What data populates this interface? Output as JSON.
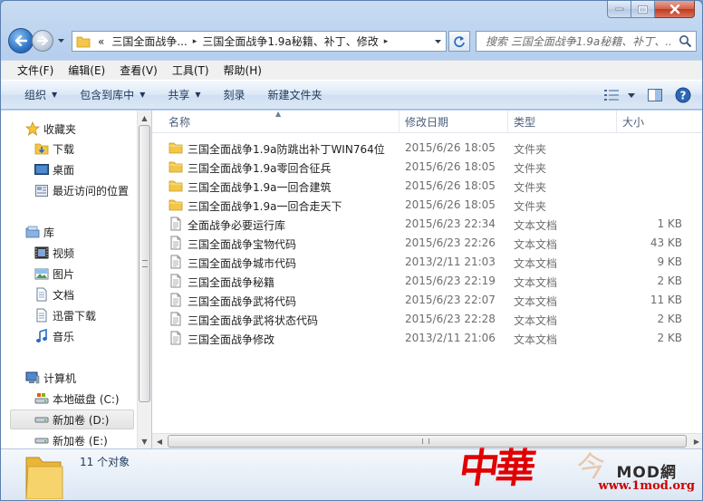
{
  "window": {
    "minimize_glyph": "–",
    "maximize_glyph": "□",
    "close_glyph": "✕"
  },
  "address": {
    "overflow": "«",
    "segments": [
      "三国全面战争...",
      "三国全面战争1.9a秘籍、补丁、修改"
    ],
    "separator": "▸"
  },
  "search": {
    "placeholder": "搜索 三国全面战争1.9a秘籍、补丁、..."
  },
  "menubar": {
    "items": [
      "文件(F)",
      "编辑(E)",
      "查看(V)",
      "工具(T)",
      "帮助(H)"
    ]
  },
  "toolbar": {
    "organize": "组织",
    "include_library": "包含到库中",
    "share": "共享",
    "burn": "刻录",
    "new_folder": "新建文件夹"
  },
  "navpane": {
    "favorites": "收藏夹",
    "downloads": "下载",
    "desktop": "桌面",
    "recent": "最近访问的位置",
    "libraries": "库",
    "videos": "视频",
    "pictures": "图片",
    "documents": "文档",
    "thunder": "迅雷下载",
    "music": "音乐",
    "computer": "计算机",
    "drive_c": "本地磁盘 (C:)",
    "drive_d": "新加卷 (D:)",
    "drive_e": "新加卷 (E:)"
  },
  "columns": {
    "name": "名称",
    "date": "修改日期",
    "type": "类型",
    "size": "大小"
  },
  "files": [
    {
      "name": "三国全面战争1.9a防跳出补丁WIN764位",
      "date": "2015/6/26 18:05",
      "type": "文件夹",
      "size": "",
      "kind": "folder"
    },
    {
      "name": "三国全面战争1.9a零回合征兵",
      "date": "2015/6/26 18:05",
      "type": "文件夹",
      "size": "",
      "kind": "folder"
    },
    {
      "name": "三国全面战争1.9a一回合建筑",
      "date": "2015/6/26 18:05",
      "type": "文件夹",
      "size": "",
      "kind": "folder"
    },
    {
      "name": "三国全面战争1.9a一回合走天下",
      "date": "2015/6/26 18:05",
      "type": "文件夹",
      "size": "",
      "kind": "folder"
    },
    {
      "name": "全面战争必要运行库",
      "date": "2015/6/23 22:34",
      "type": "文本文档",
      "size": "1 KB",
      "kind": "text"
    },
    {
      "name": "三国全面战争宝物代码",
      "date": "2015/6/23 22:26",
      "type": "文本文档",
      "size": "43 KB",
      "kind": "text"
    },
    {
      "name": "三国全面战争城市代码",
      "date": "2013/2/11 21:03",
      "type": "文本文档",
      "size": "9 KB",
      "kind": "text"
    },
    {
      "name": "三国全面战争秘籍",
      "date": "2015/6/23 22:19",
      "type": "文本文档",
      "size": "2 KB",
      "kind": "text"
    },
    {
      "name": "三国全面战争武将代码",
      "date": "2015/6/23 22:07",
      "type": "文本文档",
      "size": "11 KB",
      "kind": "text"
    },
    {
      "name": "三国全面战争武将状态代码",
      "date": "2015/6/23 22:28",
      "type": "文本文档",
      "size": "2 KB",
      "kind": "text"
    },
    {
      "name": "三国全面战争修改",
      "date": "2013/2/11 21:06",
      "type": "文本文档",
      "size": "2 KB",
      "kind": "text"
    }
  ],
  "details": {
    "count": "11 个对象"
  },
  "watermark": {
    "mark1": "中華",
    "mark2": "今",
    "brand": "MOD網",
    "url": "www.1mod.org"
  },
  "colors": {
    "folder": "#f3c64a",
    "accent": "#1e395b",
    "watermark_red": "#cc0000"
  }
}
